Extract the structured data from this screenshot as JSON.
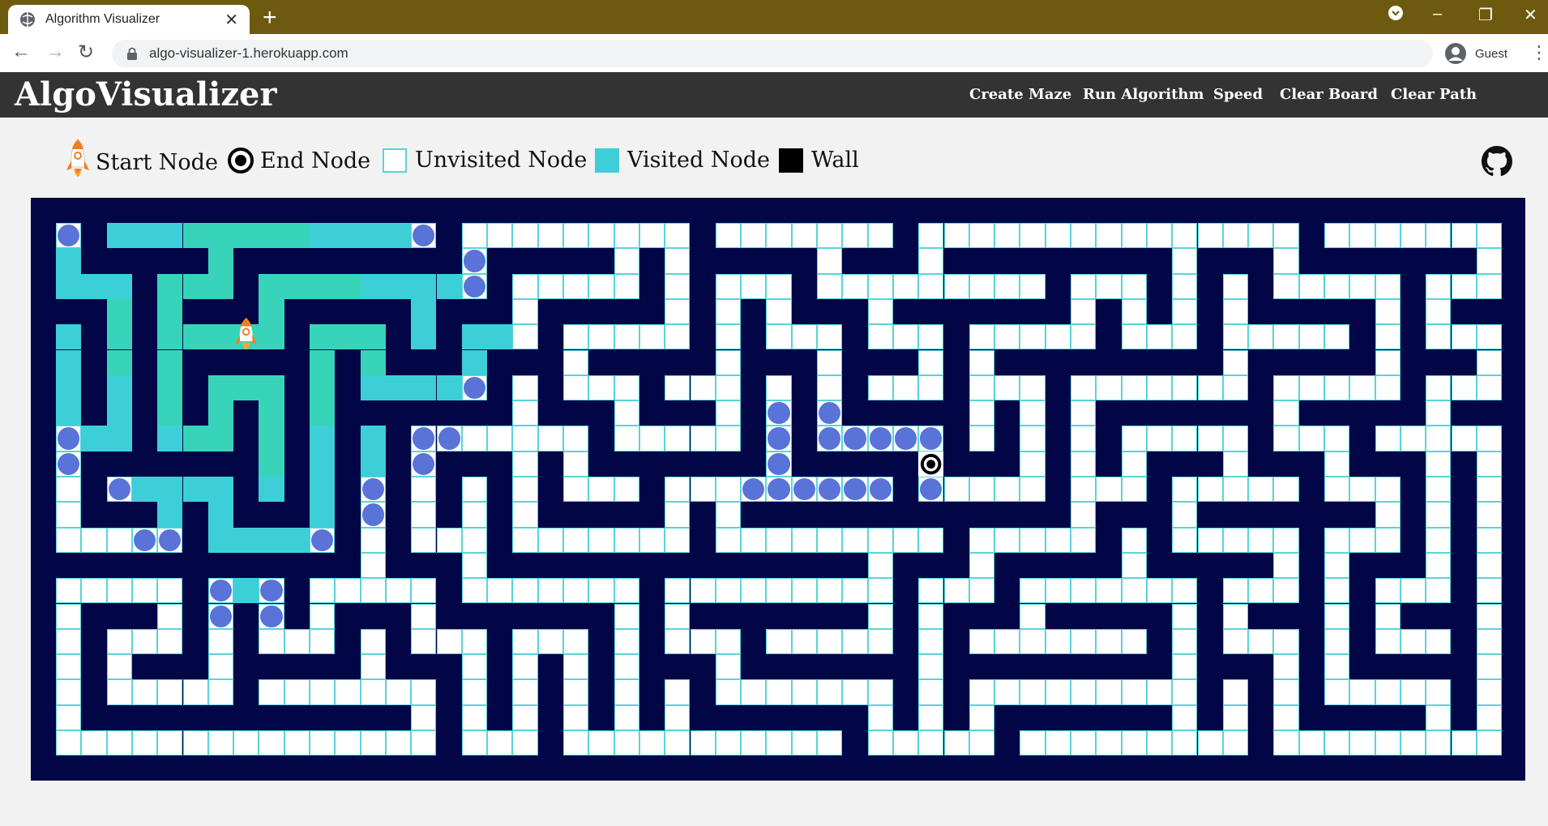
{
  "browser": {
    "tab_title": "Algorithm Visualizer",
    "url": "algo-visualizer-1.herokuapp.com",
    "profile": "Guest"
  },
  "app": {
    "brand": "AlgoVisualizer",
    "nav": [
      "Create Maze",
      "Run Algorithm",
      "Speed",
      "Clear Board",
      "Clear Path"
    ]
  },
  "legend": {
    "start": "Start Node",
    "end": "End Node",
    "unvisited": "Unvisited Node",
    "visited": "Visited Node",
    "wall": "Wall"
  },
  "colors": {
    "wall": "#020546",
    "unvisited": "#ffffff",
    "unvisited_border": "#56d5d9",
    "visited": "#3dcfd8",
    "visited_green": "#37d4b9",
    "frontier": "#5a73d8",
    "path": "#ffff66",
    "navbar": "#333333",
    "tabbar": "#6e5a0f"
  },
  "grid": {
    "cols": 57,
    "rows": 21,
    "start": [
      7,
      4
    ],
    "end": [
      34,
      9
    ],
    "walls_style": "maze"
  }
}
